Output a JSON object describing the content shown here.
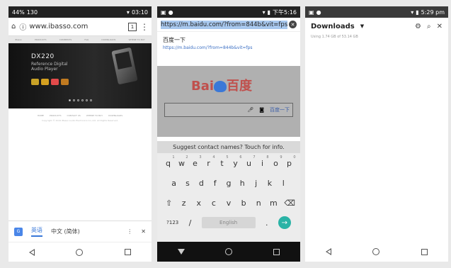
{
  "phone1": {
    "status": {
      "left": "44%",
      "signal": "130",
      "time": "03:10"
    },
    "url": "www.ibasso.com",
    "tab_count": "1",
    "nav_items": [
      "iBasso",
      "PRODUCTS",
      "COMMENTS",
      "FAQ",
      "DOWNLOADS",
      "WHERE TO BUY"
    ],
    "hero": {
      "title": "DX220",
      "line1": "Reference Digital",
      "line2": "Audio Player"
    },
    "footer_links": [
      "HOME",
      "PRODUCTS",
      "CONTACT US",
      "WHERE TO BUY",
      "DOWNLOADS"
    ],
    "copyright": "Copyright © 2019 iBasso Audio Electronics Co.,Ltd. All Rights Reserved.",
    "translate": {
      "lang1": "英语",
      "lang2": "中文 (简体)"
    }
  },
  "phone2": {
    "status": {
      "time": "下午5:16"
    },
    "url": "https://m.baidu.com/?from=844b&vit=fps",
    "suggestion_title": "百度一下",
    "suggestion_url": "https://m.baidu.com/?from=844b&vit=fps",
    "logo_text_1": "Bai",
    "logo_text_2": "百度",
    "search_button": "百度一下",
    "keyboard_hint": "Suggest contact names? Touch for info.",
    "row1": [
      "q",
      "w",
      "e",
      "r",
      "t",
      "y",
      "u",
      "i",
      "o",
      "p"
    ],
    "row1_nums": [
      "1",
      "2",
      "3",
      "4",
      "5",
      "6",
      "7",
      "8",
      "9",
      "0"
    ],
    "row2": [
      "a",
      "s",
      "d",
      "f",
      "g",
      "h",
      "j",
      "k",
      "l"
    ],
    "row3": [
      "z",
      "x",
      "c",
      "v",
      "b",
      "n",
      "m"
    ],
    "sym_key": "?123",
    "slash_key": "/",
    "space_label": "English",
    "period_key": "."
  },
  "phone3": {
    "status": {
      "time": "5:29 pm"
    },
    "title": "Downloads",
    "usage": "Using 1.74 GB of 53.14 GB"
  }
}
